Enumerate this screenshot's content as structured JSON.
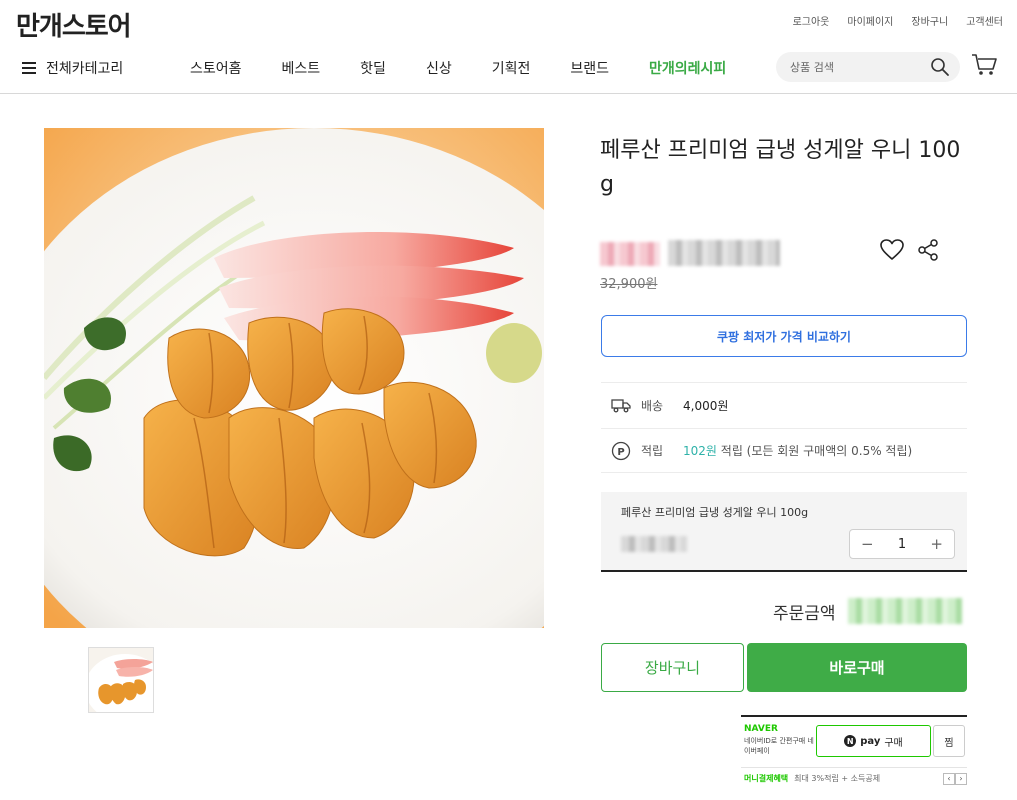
{
  "header": {
    "logo": "만개스토어",
    "util_links": [
      "로그아웃",
      "마이페이지",
      "장바구니",
      "고객센터"
    ],
    "all_categories": "전체카테고리",
    "menu": [
      "스토어홈",
      "베스트",
      "핫딜",
      "신상",
      "기획전",
      "브랜드"
    ],
    "recipe_menu": "만개의레시피",
    "search_placeholder": "상품 검색"
  },
  "product": {
    "title": "페루산 프리미엄 급냉 성게알 우니 100g",
    "original_price": "32,900원",
    "compare_button": "쿠팡 최저가 가격 비교하기",
    "shipping_label": "배송",
    "shipping_value": "4,000원",
    "points_label": "적립",
    "points_value": "102원",
    "points_note": "적립 (모든 회원 구매액의 0.5% 적립)",
    "option_name": "페루산 프리미엄 급냉 성게알 우니 100g",
    "quantity": "1",
    "total_label": "주문금액",
    "cart_button": "장바구니",
    "buy_button": "바로구매"
  },
  "naverpay": {
    "brand": "NAVER",
    "sub": "네이버ID로 간편구매 네이버페이",
    "pay_label": "pay",
    "pay_suffix": "구매",
    "n_mark": "N",
    "zzim": "찜",
    "foot_highlight": "머니결제혜택",
    "foot_text": "최대 3%적립 + 소득공제",
    "prev": "‹",
    "next": "›"
  },
  "stepper": {
    "minus": "−",
    "plus": "+"
  },
  "colors": {
    "accent_green": "#3aaa45",
    "compare_blue": "#2f6fdf",
    "points_teal": "#2fb2a9",
    "naver_green": "#1ec800"
  }
}
